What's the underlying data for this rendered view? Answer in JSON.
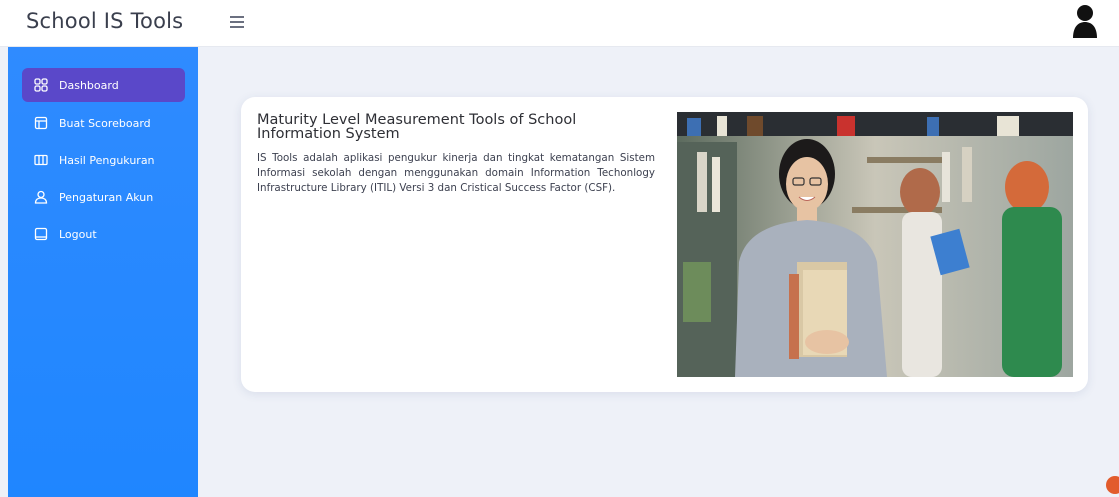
{
  "app": {
    "title": "School IS Tools"
  },
  "sidebar": {
    "items": [
      {
        "label": "Dashboard",
        "icon": "grid-icon",
        "active": true
      },
      {
        "label": "Buat Scoreboard",
        "icon": "layout-icon",
        "active": false
      },
      {
        "label": "Hasil Pengukuran",
        "icon": "columns-icon",
        "active": false
      },
      {
        "label": "Pengaturan Akun",
        "icon": "user-icon",
        "active": false
      },
      {
        "label": "Logout",
        "icon": "square-icon",
        "active": false
      }
    ]
  },
  "main": {
    "title": "Maturity Level Measurement Tools of School Information System",
    "description": "IS Tools adalah aplikasi pengukur kinerja dan tingkat kematangan Sistem Informasi sekolah dengan menggunakan domain Information Techonlogy Infrastructure Library (ITIL) Versi 3 dan Cristical Success Factor (CSF)."
  },
  "colors": {
    "sidebar": "#2a8bff",
    "active_item": "#5a48c9",
    "background": "#eef1f8"
  }
}
